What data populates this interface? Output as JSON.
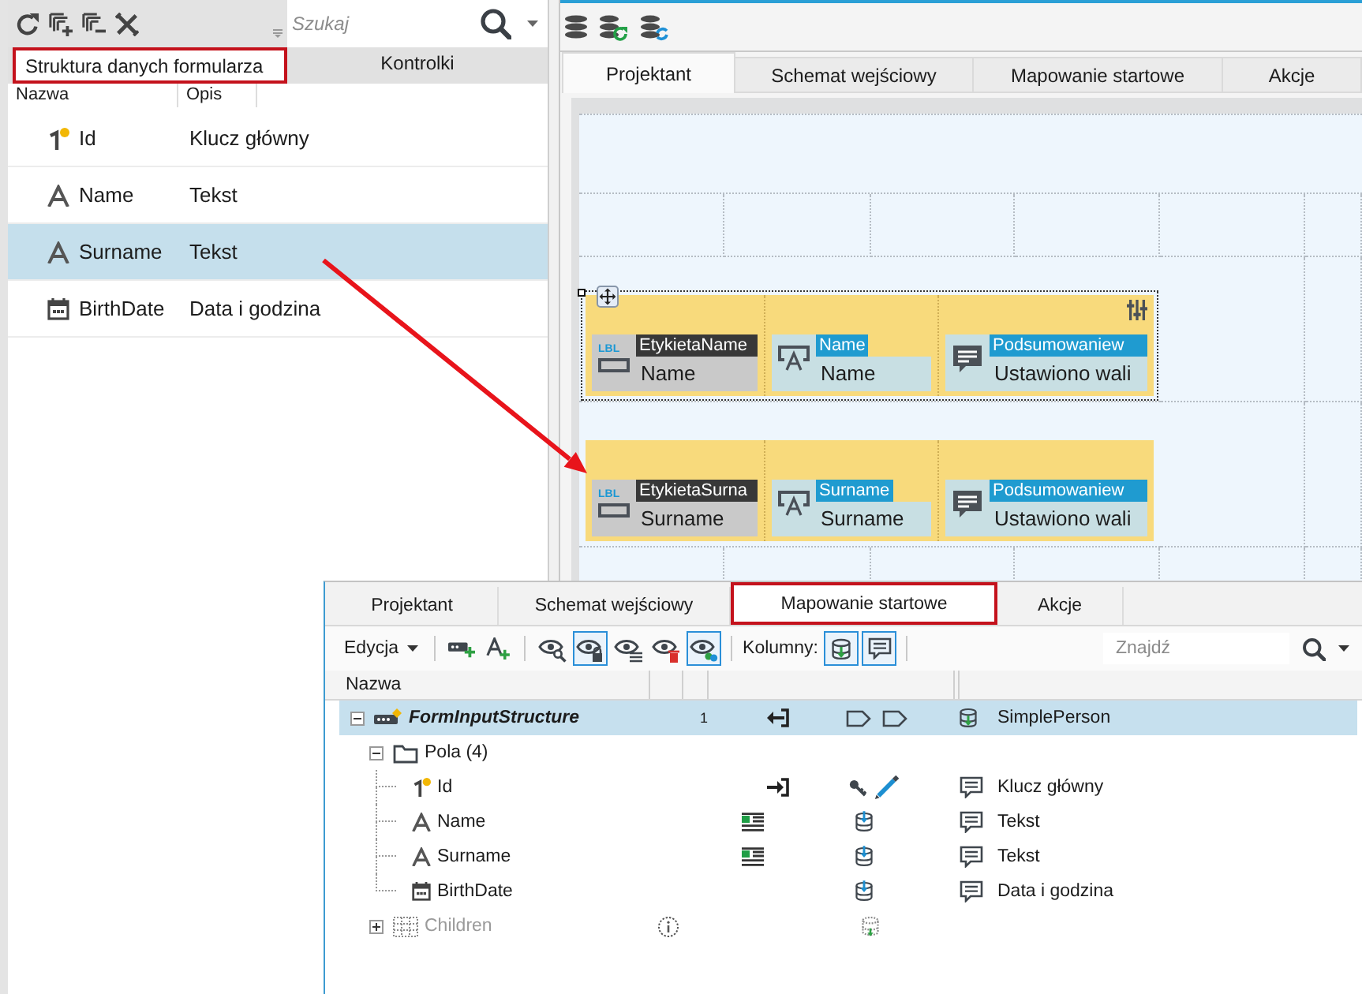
{
  "data_panel": {
    "search": {
      "placeholder": "Szukaj"
    },
    "tabs": [
      {
        "label": "Struktura danych formularza",
        "selected": true,
        "highlighted": true
      },
      {
        "label": "Kontrolki",
        "selected": false,
        "highlighted": false
      }
    ],
    "columns": [
      "Nazwa",
      "Opis"
    ],
    "rows": [
      {
        "kind": "key",
        "name": "Id",
        "description": "Klucz główny",
        "selected": false
      },
      {
        "kind": "text",
        "name": "Name",
        "description": "Tekst",
        "selected": false
      },
      {
        "kind": "text",
        "name": "Surname",
        "description": "Tekst",
        "selected": true
      },
      {
        "kind": "date",
        "name": "BirthDate",
        "description": "Data i godzina",
        "selected": false
      }
    ]
  },
  "designer": {
    "tabs": [
      {
        "label": "Projektant",
        "selected": true
      },
      {
        "label": "Schemat wejściowy",
        "selected": false
      },
      {
        "label": "Mapowanie startowe",
        "selected": false
      },
      {
        "label": "Akcje",
        "selected": false
      }
    ],
    "rows": [
      {
        "selected": true,
        "controls": [
          {
            "kind": "label",
            "badge": "LBL",
            "tag": "EtykietaName",
            "value": "Name"
          },
          {
            "kind": "textbox",
            "tag": "Name",
            "value": "Name"
          },
          {
            "kind": "summary",
            "tag": "Podsumowaniew",
            "value": "Ustawiono wali"
          }
        ]
      },
      {
        "selected": false,
        "controls": [
          {
            "kind": "label",
            "badge": "LBL",
            "tag": "EtykietaSurna",
            "value": "Surname"
          },
          {
            "kind": "textbox",
            "tag": "Surname",
            "value": "Surname"
          },
          {
            "kind": "summary",
            "tag": "Podsumowaniew",
            "value": "Ustawiono wali"
          }
        ]
      }
    ]
  },
  "mapping_panel": {
    "tabs": [
      {
        "label": "Projektant",
        "selected": false,
        "highlighted": false
      },
      {
        "label": "Schemat wejściowy",
        "selected": false,
        "highlighted": false
      },
      {
        "label": "Mapowanie startowe",
        "selected": true,
        "highlighted": true
      },
      {
        "label": "Akcje",
        "selected": false,
        "highlighted": false
      }
    ],
    "toolbar": {
      "menu": "Edycja",
      "view_toggles": [
        {
          "kind": "search",
          "on": false
        },
        {
          "kind": "lock",
          "on": true
        },
        {
          "kind": "list",
          "on": false
        },
        {
          "kind": "delete",
          "on": false
        },
        {
          "kind": "link",
          "on": true
        }
      ],
      "columns_label": "Kolumny:",
      "column_toggles": [
        {
          "kind": "database",
          "on": true
        },
        {
          "kind": "comment",
          "on": true
        }
      ],
      "search": {
        "placeholder": "Znajdź"
      }
    },
    "columns": [
      "Nazwa"
    ],
    "tree": [
      {
        "kind": "structure",
        "name": "FormInputStructure",
        "count": "1",
        "target": "SimplePerson",
        "selected": true,
        "disabled": false,
        "expanded": true,
        "children": [
          {
            "kind": "folder",
            "name": "Pola (4)",
            "selected": false,
            "disabled": false,
            "expanded": true,
            "children": [
              {
                "kind": "key",
                "name": "Id",
                "description": "Klucz główny",
                "selected": false,
                "disabled": false
              },
              {
                "kind": "text",
                "name": "Name",
                "description": "Tekst",
                "selected": false,
                "disabled": false
              },
              {
                "kind": "text",
                "name": "Surname",
                "description": "Tekst",
                "selected": false,
                "disabled": false
              },
              {
                "kind": "date",
                "name": "BirthDate",
                "description": "Data i godzina",
                "selected": false,
                "disabled": false
              }
            ]
          },
          {
            "kind": "collection",
            "name": "Children",
            "selected": false,
            "disabled": true,
            "expanded": false
          }
        ]
      }
    ]
  }
}
